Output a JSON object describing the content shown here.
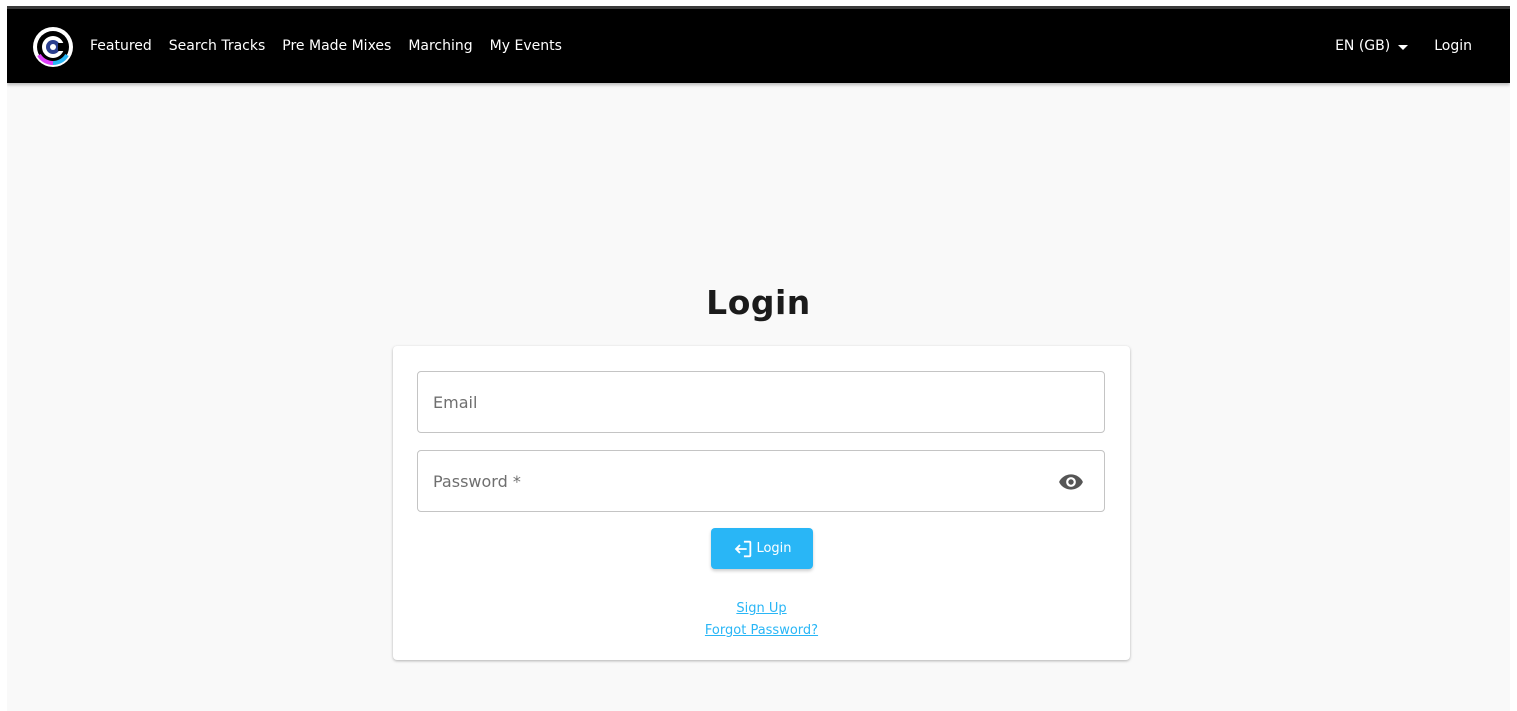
{
  "header": {
    "nav_items": [
      {
        "label": "Featured"
      },
      {
        "label": "Search Tracks"
      },
      {
        "label": "Pre Made Mixes"
      },
      {
        "label": "Marching"
      },
      {
        "label": "My Events"
      }
    ],
    "language_label": "EN (GB)",
    "login_label": "Login"
  },
  "main": {
    "title": "Login",
    "email_placeholder": "Email",
    "email_value": "",
    "password_placeholder": "Password *",
    "password_value": "",
    "login_button_label": "Login",
    "signup_link": "Sign Up",
    "forgot_link": "Forgot Password?"
  },
  "colors": {
    "accent": "#29b6f6",
    "header_bg": "#000000",
    "page_bg": "#f9f9f9"
  },
  "icons": {
    "logo": "app-logo-icon",
    "language": "caret-down-icon",
    "password_visibility": "eye-icon",
    "login_button": "login-icon"
  }
}
